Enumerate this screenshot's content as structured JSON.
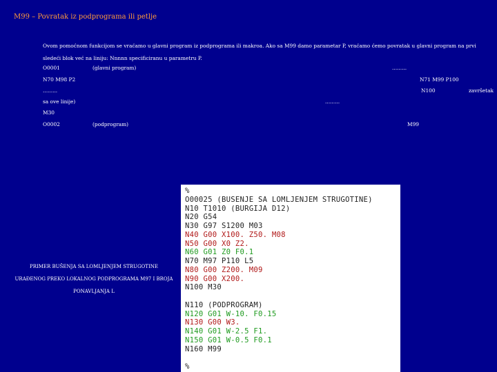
{
  "title": "M99 – Povratak iz podprograma ili petlje",
  "intro": "Ovom pomoćnom funkcijom se vraćamo u glavni program iz podprograma ili makroa. Ako sa M99 damo parametar P, vraćamo ćemo povratak u glavni program na prvi sledeći blok već na liniju: Nnnnn specificiranu u parametru P.",
  "example": {
    "o1_label": "O0001",
    "o1_comment": "(glavni program)",
    "dots_right": ".........",
    "n70": "N70 M98 P2",
    "n71": "N71 M99 P100",
    "dots_left": ".........",
    "n100": "N100",
    "zavrsetak": "završetak",
    "ova_linija": "sa ove linije)",
    "dots_mid": ".........",
    "m30": "M30",
    "o2_label": "O0002",
    "o2_comment": "(podprogram)",
    "m99": "M99"
  },
  "caption": "PRIMER BUŠENJA SA LOMLJENJEM STRUGOTINE URAĐENOG PREKO LOKALNOG PODPROGRAMA M97 I BROJA PONAVLJANJA L",
  "code": {
    "colors": {
      "black": "#222222",
      "red": "#b01818",
      "green": "#1e9a1e"
    },
    "lines": [
      {
        "text": "%",
        "color": "black"
      },
      {
        "text": "O00025 (BUSENJE SA LOMLJENJEM STRUGOTINE)",
        "color": "black"
      },
      {
        "text": "N10 T1010 (BURGIJA D12)",
        "color": "black"
      },
      {
        "text": "N20 G54",
        "color": "black"
      },
      {
        "text": "N30 G97 S1200 M03",
        "color": "black"
      },
      {
        "text": "N40 G00 X100. Z50. M08",
        "color": "red"
      },
      {
        "text": "N50 G00 X0 Z2.",
        "color": "red"
      },
      {
        "text": "N60 G01 Z0 F0.1",
        "color": "green"
      },
      {
        "text": "N70 M97 P110 L5",
        "color": "black"
      },
      {
        "text": "N80 G00 Z200. M09",
        "color": "red"
      },
      {
        "text": "N90 G00 X200.",
        "color": "red"
      },
      {
        "text": "N100 M30",
        "color": "black"
      },
      {
        "text": "",
        "color": "black"
      },
      {
        "text": "N110 (PODPROGRAM)",
        "color": "black"
      },
      {
        "text": "N120 G01 W-10. F0.15",
        "color": "green"
      },
      {
        "text": "N130 G00 W3.",
        "color": "red"
      },
      {
        "text": "N140 G01 W-2.5 F1.",
        "color": "green"
      },
      {
        "text": "N150 G01 W-0.5 F0.1",
        "color": "green"
      },
      {
        "text": "N160 M99",
        "color": "black"
      },
      {
        "text": "",
        "color": "black"
      },
      {
        "text": "%",
        "color": "black"
      }
    ]
  }
}
